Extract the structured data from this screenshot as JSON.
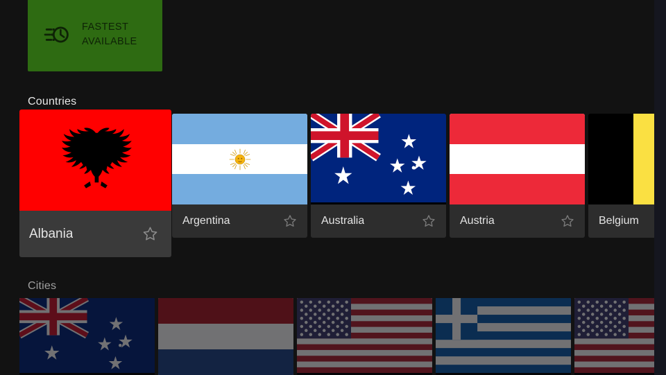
{
  "screen": {
    "background_color": "#121212",
    "right_gutter_color": "#15161f"
  },
  "fastest": {
    "label": "FASTEST\nAVAILABLE",
    "icon": "speed-clock-icon",
    "background_color": "#2e6b12",
    "text_color": "#0e2306"
  },
  "sections": [
    {
      "id": "countries",
      "title": "Countries",
      "active": true
    },
    {
      "id": "cities",
      "title": "Cities",
      "active": false
    }
  ],
  "countries": {
    "title": "Countries",
    "items": [
      {
        "name": "Albania",
        "flag": "albania",
        "selected": true,
        "favorite": false,
        "star_icon": "star-outline-icon"
      },
      {
        "name": "Argentina",
        "flag": "argentina",
        "selected": false,
        "favorite": false,
        "star_icon": "star-outline-icon"
      },
      {
        "name": "Australia",
        "flag": "australia",
        "selected": false,
        "favorite": false,
        "star_icon": "star-outline-icon"
      },
      {
        "name": "Austria",
        "flag": "austria",
        "selected": false,
        "favorite": false,
        "star_icon": "star-outline-icon"
      },
      {
        "name": "Belgium",
        "flag": "belgium",
        "selected": false,
        "favorite": false,
        "star_icon": "star-outline-icon",
        "clipped": true
      }
    ]
  },
  "cities": {
    "title": "Cities",
    "dimmed": true,
    "items": [
      {
        "flag": "australia"
      },
      {
        "flag": "netherlands"
      },
      {
        "flag": "usa"
      },
      {
        "flag": "greece"
      },
      {
        "flag": "usa"
      }
    ]
  },
  "colors": {
    "card_background": "#2d2d2d",
    "card_selected_background": "#3a3a3a",
    "card_label": "#e4e4e4",
    "section_active": "#e8e8e8",
    "section_inactive": "#a0a0a0",
    "albania_red": "#ff0000",
    "argentina_blue": "#74acdf",
    "australia_blue": "#00247d",
    "austria_red": "#ed2939",
    "belgium_yellow": "#fae042",
    "greece_blue": "#0d5eaf"
  }
}
